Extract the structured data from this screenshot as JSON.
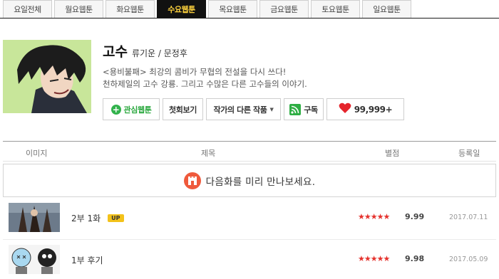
{
  "tabs": [
    "요일전체",
    "월요웹툰",
    "화요웹툰",
    "수요웹툰",
    "목요웹툰",
    "금요웹툰",
    "토요웹툰",
    "일요웹툰"
  ],
  "active_tab": "수요웹툰",
  "comic": {
    "title": "고수",
    "author": "류기운 / 문정후",
    "desc_line1": "<용비불패> 최강의 콤비가 무협의 전설을 다시 쓰다!",
    "desc_line2": "천하제일의 고수 강룡. 그리고 수많은 다른 고수들의 이야기."
  },
  "buttons": {
    "favorite": "관심웹툰",
    "first_episode": "첫회보기",
    "other_works": "작가의 다른 작품",
    "rss": "구독",
    "likes": "99,999+"
  },
  "table_headers": {
    "image": "이미지",
    "title": "제목",
    "rating": "별점",
    "date": "등록일"
  },
  "banner": {
    "text": "다음화를 미리 만나보세요."
  },
  "episodes": [
    {
      "title": "2부 1화",
      "badge": "UP",
      "stars": "★★★★★",
      "score": "9.99",
      "date": "2017.07.11"
    },
    {
      "title": "1부 후기",
      "badge": "",
      "stars": "★★★★★",
      "score": "9.98",
      "date": "2017.05.09"
    }
  ],
  "colors": {
    "tab_active_bg": "#111111",
    "tab_active_text": "#ffd33d",
    "accent_green": "#2aa83e",
    "star_red": "#e5322d",
    "heart_red": "#e5242c"
  }
}
